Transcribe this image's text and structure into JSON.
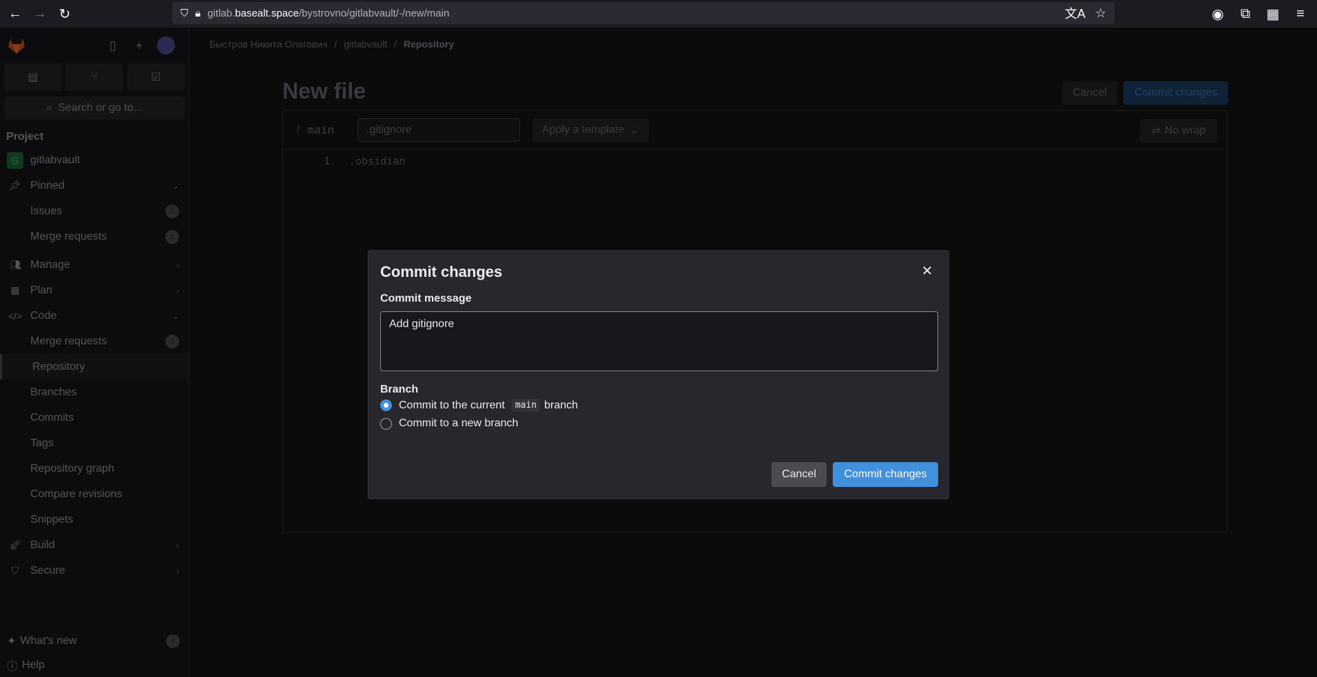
{
  "browser": {
    "url_muted_prefix": "gitlab.",
    "url_host": "basealt.space",
    "url_path": "/bystrovno/gitlabvault/-/new/main"
  },
  "sidebar": {
    "search_placeholder": "Search or go to...",
    "section_label": "Project",
    "project_name": "gitlabvault",
    "project_initial": "G",
    "pinned": {
      "label": "Pinned",
      "items": [
        {
          "label": "Issues",
          "count": "0"
        },
        {
          "label": "Merge requests",
          "count": "0"
        }
      ]
    },
    "groups": {
      "manage": "Manage",
      "plan": "Plan",
      "code": "Code",
      "build": "Build",
      "secure": "Secure"
    },
    "code_items": [
      {
        "label": "Merge requests",
        "count": "0"
      },
      {
        "label": "Repository"
      },
      {
        "label": "Branches"
      },
      {
        "label": "Commits"
      },
      {
        "label": "Tags"
      },
      {
        "label": "Repository graph"
      },
      {
        "label": "Compare revisions"
      },
      {
        "label": "Snippets"
      }
    ],
    "whats_new": "What's new",
    "whats_new_count": "4",
    "help": "Help"
  },
  "breadcrumb": {
    "user": "Быстров Никита Олегович",
    "project": "gitlabvault",
    "current": "Repository"
  },
  "page": {
    "title": "New file",
    "cancel_label": "Cancel",
    "commit_label": "Commit changes"
  },
  "editor": {
    "branch": "main",
    "filename": ".gitignore",
    "template_label": "Apply a template",
    "nowrap_label": "No wrap",
    "line_number": "1",
    "line_text": ".obsidian"
  },
  "modal": {
    "title": "Commit changes",
    "commit_message_label": "Commit message",
    "commit_message_value": "Add gitignore",
    "branch_label": "Branch",
    "option_current_prefix": "Commit to the current",
    "option_current_branch": "main",
    "option_current_suffix": "branch",
    "option_new": "Commit to a new branch",
    "cancel_label": "Cancel",
    "commit_label": "Commit changes"
  },
  "colors": {
    "accent_blue": "#428fdc",
    "modal_bg": "#28272d"
  }
}
